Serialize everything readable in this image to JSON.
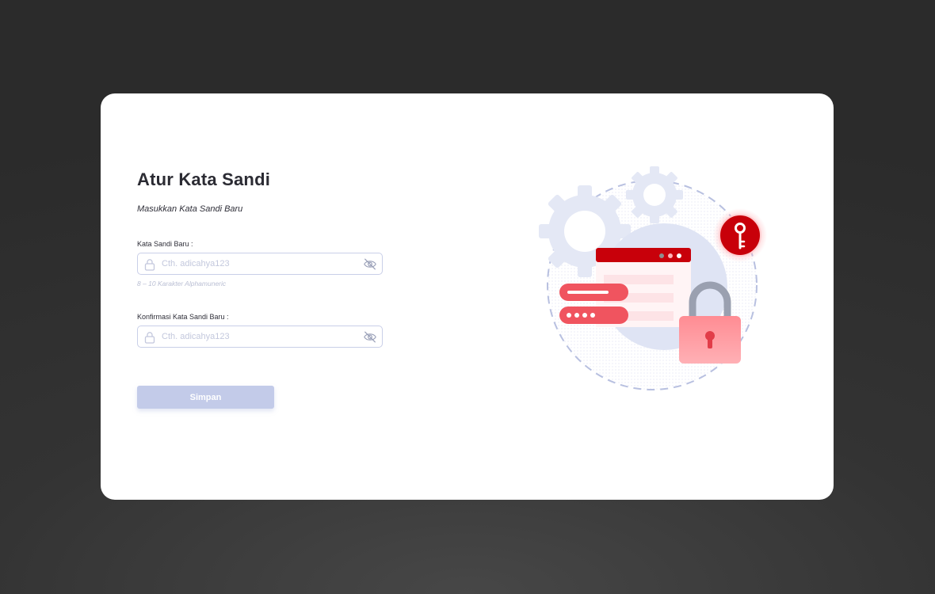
{
  "page": {
    "title": "Atur Kata Sandi",
    "subtitle": "Masukkan Kata Sandi Baru"
  },
  "form": {
    "password": {
      "label": "Kata Sandi Baru :",
      "placeholder": "Cth. adicahya123",
      "value": "",
      "hint": "8 – 10 Karakter Alphamuneric",
      "lock_icon": "lock-icon",
      "toggle_icon": "eye-off-icon"
    },
    "confirm": {
      "label": "Konfirmasi Kata Sandi Baru :",
      "placeholder": "Cth. adicahya123",
      "value": "",
      "lock_icon": "lock-icon",
      "toggle_icon": "eye-off-icon"
    },
    "submit_label": "Simpan"
  },
  "colors": {
    "backdrop": "#2e2e2e",
    "card": "#ffffff",
    "title": "#2b2b33",
    "field_border": "#c9cfe8",
    "button_disabled": "#c3cbe9",
    "brand_red": "#c8000a",
    "illustration_blue": "#e4e8f5"
  }
}
